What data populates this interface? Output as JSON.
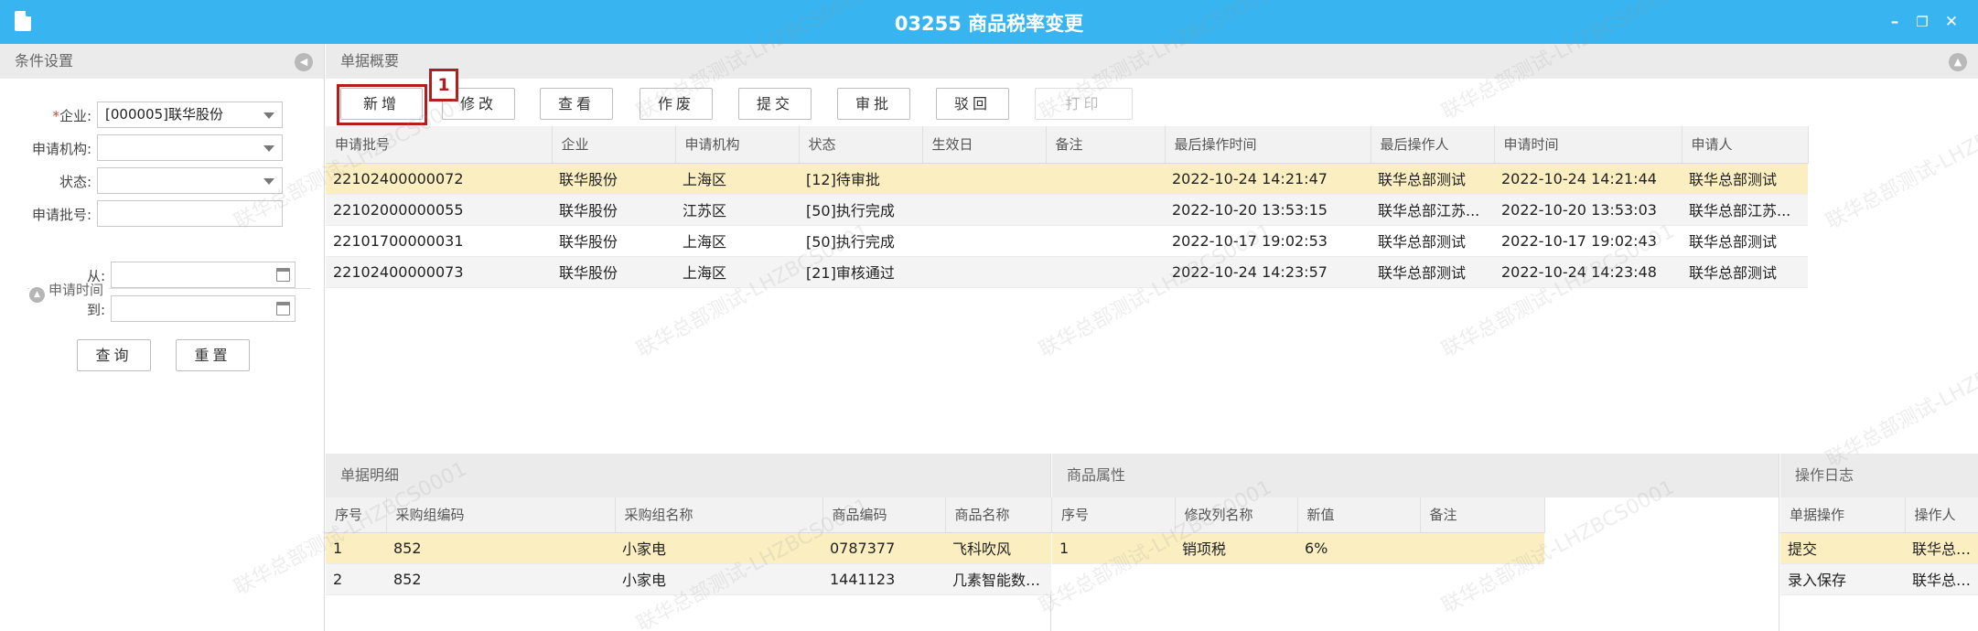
{
  "window": {
    "title": "03255 商品税率变更",
    "minimize_glyph": "–",
    "restore_glyph": "❐",
    "close_glyph": "✕"
  },
  "left_panel": {
    "title": "条件设置",
    "fields": {
      "company_label": "企业:",
      "company_value": "[000005]联华股份",
      "org_label": "申请机构:",
      "org_value": "",
      "status_label": "状态:",
      "status_value": "",
      "batch_label": "申请批号:",
      "batch_value": "",
      "time_group": "申请时间",
      "from_label": "从:",
      "from_value": "",
      "to_label": "到:",
      "to_value": ""
    },
    "buttons": {
      "query": "查询",
      "reset": "重置"
    }
  },
  "summary": {
    "title": "单据概要",
    "toolbar": {
      "add": "新增",
      "edit": "修改",
      "view": "查看",
      "void": "作废",
      "submit": "提交",
      "approve": "审批",
      "reject": "驳回",
      "print": "打印"
    },
    "callout_number": "1",
    "columns": [
      "申请批号",
      "企业",
      "申请机构",
      "状态",
      "生效日",
      "备注",
      "最后操作时间",
      "最后操作人",
      "申请时间",
      "申请人"
    ],
    "rows": [
      [
        "22102400000072",
        "联华股份",
        "上海区",
        "[12]待审批",
        "",
        "",
        "2022-10-24 14:21:47",
        "联华总部测试",
        "2022-10-24 14:21:44",
        "联华总部测试"
      ],
      [
        "22102000000055",
        "联华股份",
        "江苏区",
        "[50]执行完成",
        "",
        "",
        "2022-10-20 13:53:15",
        "联华总部江苏...",
        "2022-10-20 13:53:03",
        "联华总部江苏..."
      ],
      [
        "22101700000031",
        "联华股份",
        "上海区",
        "[50]执行完成",
        "",
        "",
        "2022-10-17 19:02:53",
        "联华总部测试",
        "2022-10-17 19:02:43",
        "联华总部测试"
      ],
      [
        "22102400000073",
        "联华股份",
        "上海区",
        "[21]审核通过",
        "",
        "",
        "2022-10-24 14:23:57",
        "联华总部测试",
        "2022-10-24 14:23:48",
        "联华总部测试"
      ]
    ]
  },
  "detail": {
    "title": "单据明细",
    "columns": [
      "序号",
      "采购组编码",
      "采购组名称",
      "商品编码",
      "商品名称"
    ],
    "rows": [
      [
        "1",
        "852",
        "小家电",
        "0787377",
        "飞科吹风"
      ],
      [
        "2",
        "852",
        "小家电",
        "1441123",
        "几素智能数显..."
      ]
    ]
  },
  "attributes": {
    "title": "商品属性",
    "columns": [
      "序号",
      "修改列名称",
      "新值",
      "备注"
    ],
    "rows": [
      [
        "1",
        "销项税",
        "6%",
        ""
      ]
    ]
  },
  "log": {
    "title": "操作日志",
    "columns": [
      "单据操作",
      "操作人"
    ],
    "rows": [
      [
        "提交",
        "联华总部测"
      ],
      [
        "录入保存",
        "联华总部测"
      ]
    ]
  },
  "watermark": "联华总部测试-LHZBCS0001",
  "colors": {
    "titlebar": "#38b5f0",
    "selected_row": "#fbeec1",
    "callout": "#b71c1c"
  }
}
